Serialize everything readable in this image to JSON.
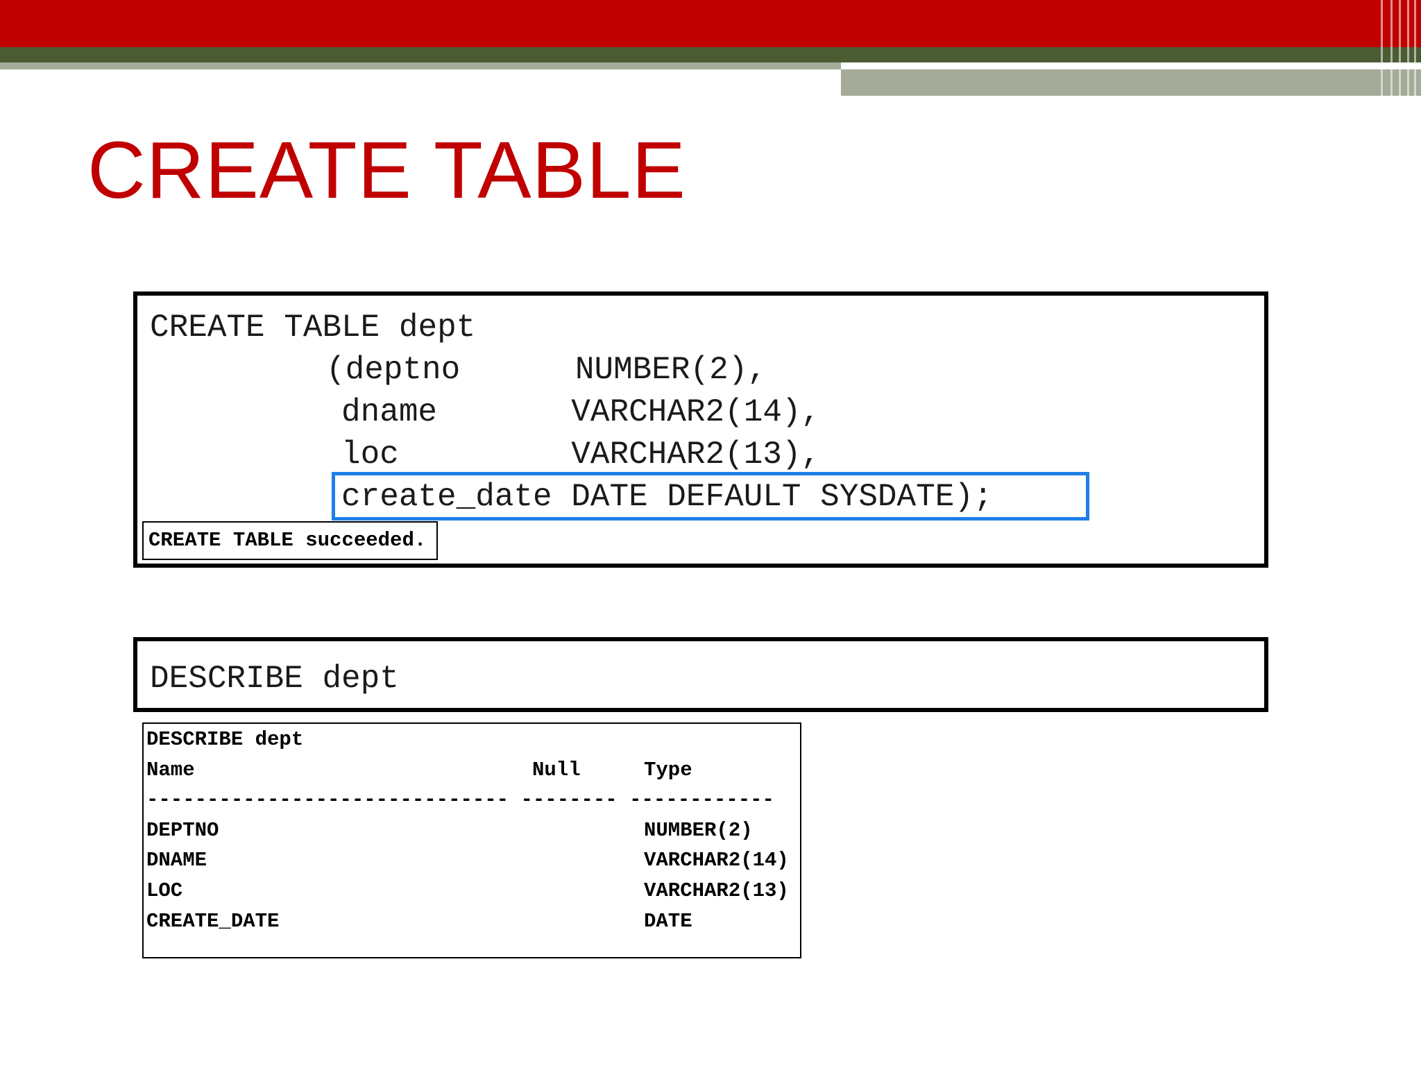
{
  "slide": {
    "title": "CREATE TABLE",
    "colors": {
      "accent_red": "#c00000",
      "header_green": "#4b5c33",
      "header_grey": "#a4ab98",
      "highlight_blue": "#1e7fe6"
    }
  },
  "create_code": {
    "line1": "CREATE TABLE dept",
    "line2": "(deptno      NUMBER(2),",
    "line3": "dname       VARCHAR2(14),",
    "line4": "loc         VARCHAR2(13),",
    "line5_highlighted": "create_date DATE DEFAULT SYSDATE);"
  },
  "create_result": "CREATE TABLE succeeded.",
  "describe_code": "DESCRIBE dept",
  "describe_output": {
    "heading": "DESCRIBE dept",
    "columns": {
      "name": "Name",
      "null": "Null",
      "type": "Type"
    },
    "separator": "------------------------------ -------- ------------",
    "rows": [
      {
        "name": "DEPTNO",
        "null": "",
        "type": "NUMBER(2)"
      },
      {
        "name": "DNAME",
        "null": "",
        "type": "VARCHAR2(14)"
      },
      {
        "name": "LOC",
        "null": "",
        "type": "VARCHAR2(13)"
      },
      {
        "name": "CREATE_DATE",
        "null": "",
        "type": "DATE"
      }
    ]
  }
}
